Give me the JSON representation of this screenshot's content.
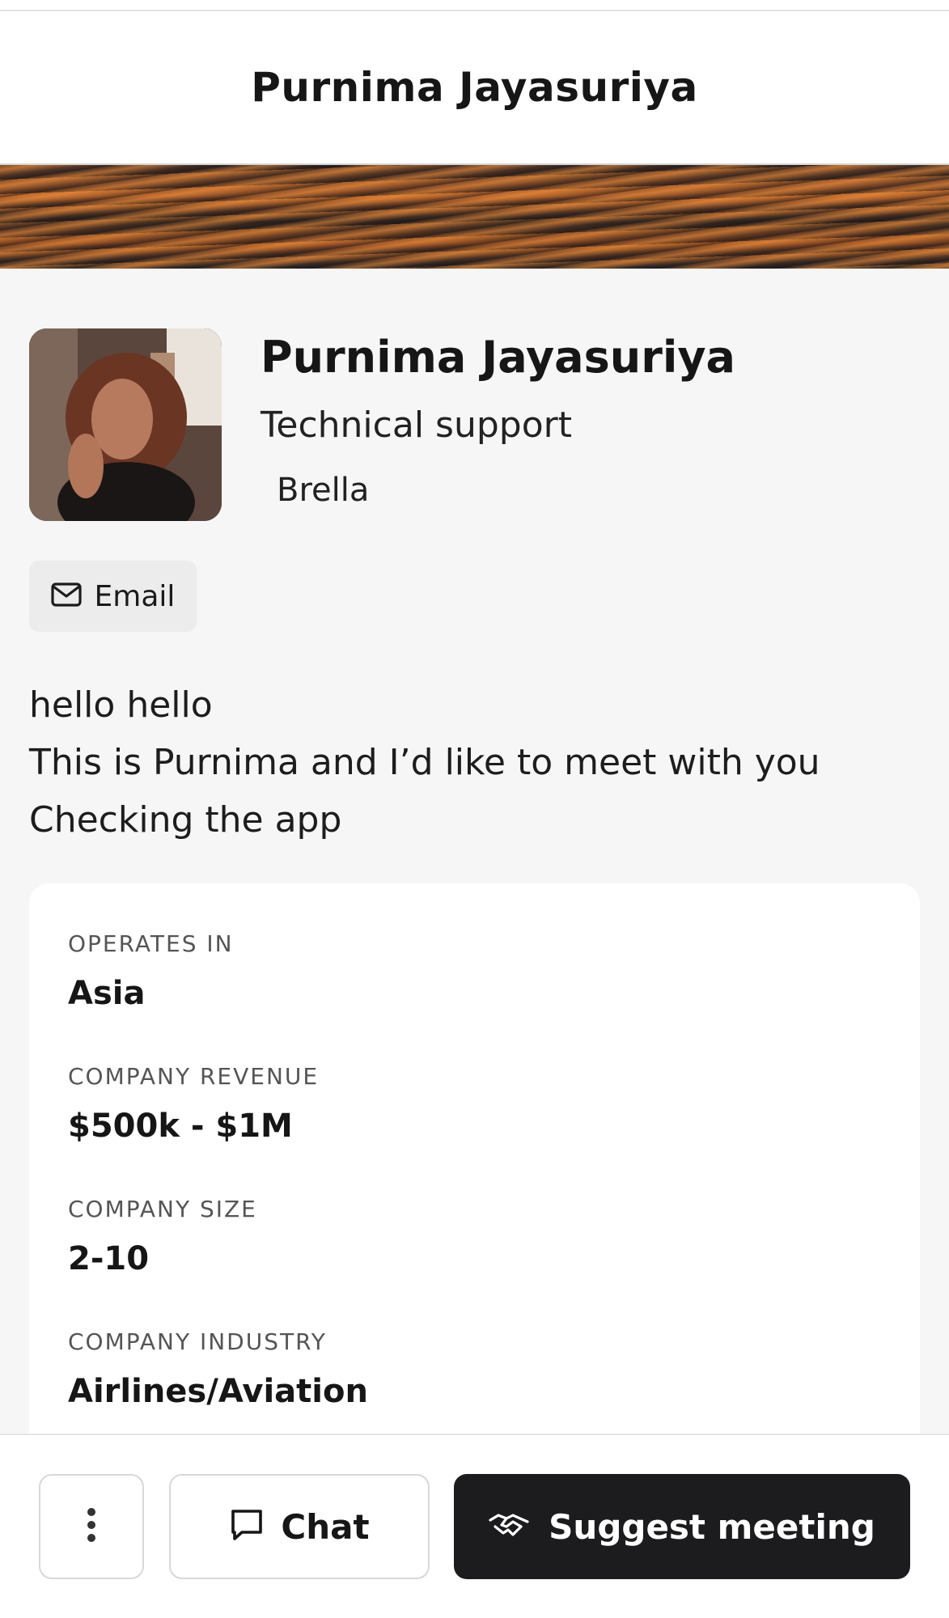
{
  "header": {
    "title": "Purnima Jayasuriya"
  },
  "profile": {
    "name": "Purnima Jayasuriya",
    "job_title": "Technical support",
    "company": "Brella",
    "email_label": "Email"
  },
  "bio": {
    "lines": [
      "hello hello",
      "This is Purnima and I’d like to meet with you",
      "Checking the app"
    ]
  },
  "details": [
    {
      "label": "OPERATES IN",
      "value": "Asia"
    },
    {
      "label": "COMPANY REVENUE",
      "value": "$500k - $1M"
    },
    {
      "label": "COMPANY SIZE",
      "value": "2-10"
    },
    {
      "label": "COMPANY INDUSTRY",
      "value": "Airlines/Aviation"
    }
  ],
  "actions": {
    "more_icon": "more-vertical-icon",
    "chat_label": "Chat",
    "chat_icon": "chat-bubble-icon",
    "suggest_label": "Suggest meeting",
    "suggest_icon": "handshake-icon"
  },
  "colors": {
    "primary_button": "#1c1c1e",
    "background": "#f6f6f6",
    "card": "#ffffff"
  }
}
